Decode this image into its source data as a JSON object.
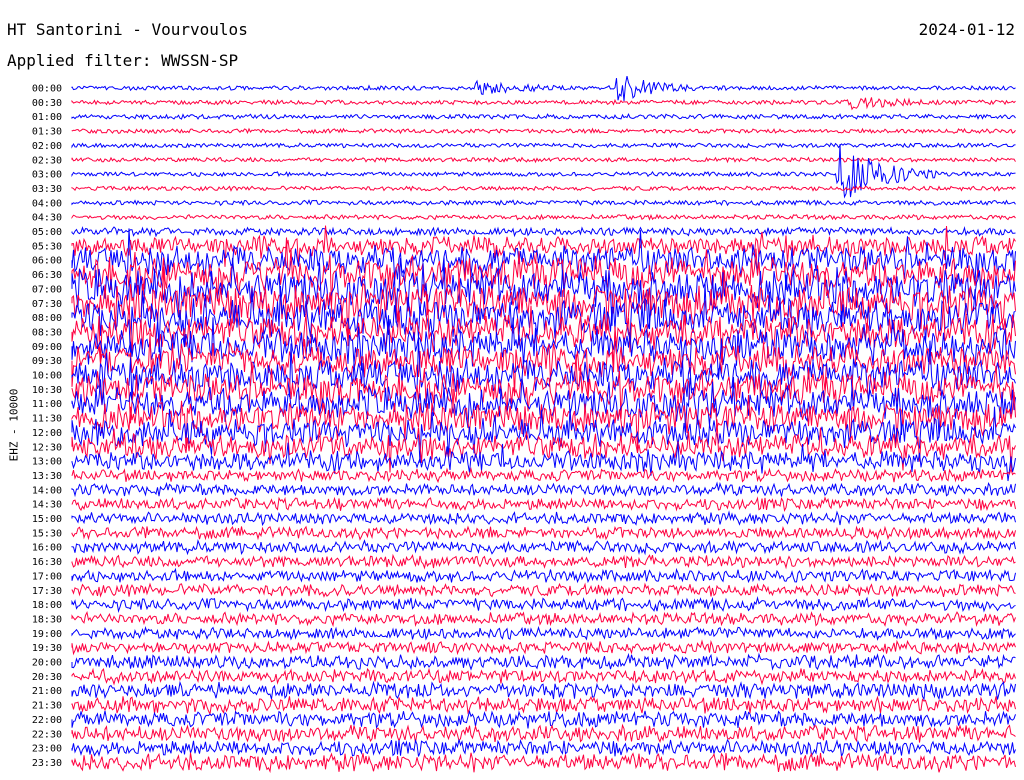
{
  "header": {
    "station": "HT Santorini - Vourvoulos",
    "date": "2024-01-12",
    "filter": "Applied filter: WWSSN-SP"
  },
  "chart_data": {
    "type": "line",
    "title": "HT Santorini - Vourvoulos",
    "ylabel": "EHZ - 10000",
    "rows": [
      "00:00",
      "00:30",
      "01:00",
      "01:30",
      "02:00",
      "02:30",
      "03:00",
      "03:30",
      "04:00",
      "04:30",
      "05:00",
      "05:30",
      "06:00",
      "06:30",
      "07:00",
      "07:30",
      "08:00",
      "08:30",
      "09:00",
      "09:30",
      "10:00",
      "10:30",
      "11:00",
      "11:30",
      "12:00",
      "12:30",
      "13:00",
      "13:30",
      "14:00",
      "14:30",
      "15:00",
      "15:30",
      "16:00",
      "16:30",
      "17:00",
      "17:30",
      "18:00",
      "18:30",
      "19:00",
      "19:30",
      "20:00",
      "20:30",
      "21:00",
      "21:30",
      "22:00",
      "22:30",
      "23:00",
      "23:30"
    ],
    "trace_colors": [
      "#0000ff",
      "#ff0040"
    ],
    "relative_noise_level": [
      0.1,
      0.1,
      0.12,
      0.1,
      0.1,
      0.1,
      0.1,
      0.1,
      0.12,
      0.12,
      0.3,
      0.9,
      1.3,
      1.6,
      1.8,
      1.8,
      1.8,
      1.7,
      1.6,
      1.6,
      1.5,
      1.5,
      1.5,
      1.4,
      1.3,
      1.2,
      0.9,
      0.5,
      0.5,
      0.5,
      0.5,
      0.5,
      0.5,
      0.5,
      0.5,
      0.5,
      0.5,
      0.5,
      0.5,
      0.5,
      0.6,
      0.6,
      0.7,
      0.7,
      0.7,
      0.7,
      0.7,
      0.8
    ],
    "events": [
      {
        "row": "00:00",
        "minute": 13.0,
        "amplitude": 5,
        "duration_min": 3
      },
      {
        "row": "00:00",
        "minute": 17.5,
        "amplitude": 12,
        "duration_min": 2.5
      },
      {
        "row": "00:30",
        "minute": 24.7,
        "amplitude": 6,
        "duration_min": 3
      },
      {
        "row": "03:00",
        "minute": 24.5,
        "amplitude": 28,
        "duration_min": 3
      },
      {
        "row": "04:00",
        "minute": 31.0,
        "amplitude": 10,
        "duration_min": 2
      }
    ]
  }
}
